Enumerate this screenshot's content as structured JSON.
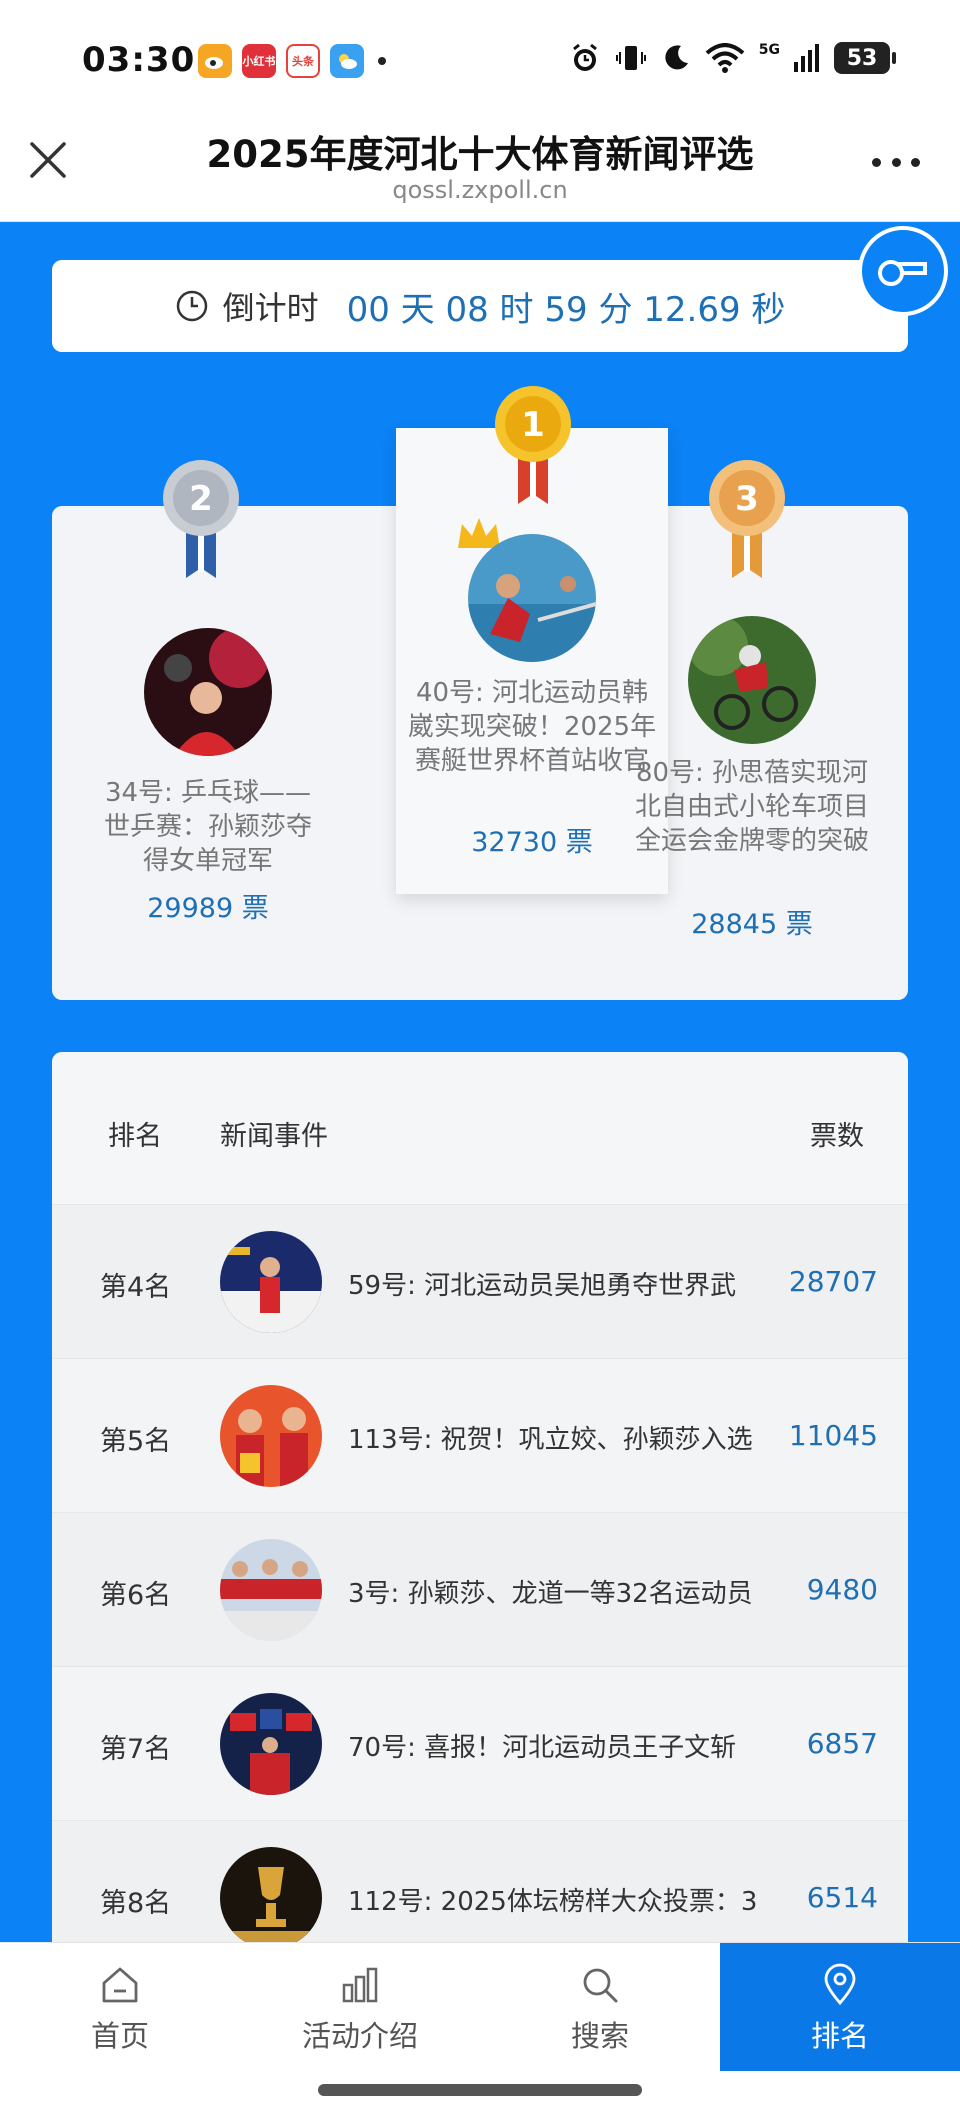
{
  "status_bar": {
    "time": "03:30",
    "apps": [
      {
        "name": "weibo-app-icon",
        "label": "",
        "color": "#f5a623"
      },
      {
        "name": "xiaohongshu-app-icon",
        "label": "小红书",
        "color": "#e0313a"
      },
      {
        "name": "toutiao-app-icon",
        "label": "头条",
        "color": "#e8413b"
      },
      {
        "name": "weather-app-icon",
        "label": "",
        "color": "#3aa0f0"
      }
    ],
    "network": "5G",
    "battery": "53"
  },
  "header": {
    "title": "2025年度河北十大体育新闻评选",
    "url": "qossl.zxpoll.cn"
  },
  "countdown": {
    "label": "倒计时",
    "value": "00 天 08 时 59 分 12.69 秒"
  },
  "podium": [
    {
      "rank": 2,
      "title": "34号: 乒乓球——世乒赛：孙颖莎夺得女单冠军",
      "votes": "29989 票",
      "medal_color": "#b8bec6"
    },
    {
      "rank": 1,
      "title": "40号: 河北运动员韩崴实现突破！2025年赛艇世界杯首站收官",
      "votes": "32730 票",
      "medal_color": "#f2b71a"
    },
    {
      "rank": 3,
      "title": "80号: 孙思蓓实现河北自由式小轮车项目全运会金牌零的突破",
      "votes": "28845 票",
      "medal_color": "#e9a84a"
    }
  ],
  "table": {
    "headers": {
      "rank": "排名",
      "news": "新闻事件",
      "votes": "票数"
    },
    "rows": [
      {
        "rank": "第4名",
        "title": "59号: 河北运动员吴旭勇夺世界武",
        "votes": "28707"
      },
      {
        "rank": "第5名",
        "title": "113号: 祝贺！巩立姣、孙颖莎入选",
        "votes": "11045"
      },
      {
        "rank": "第6名",
        "title": "3号: 孙颖莎、龙道一等32名运动员",
        "votes": "9480"
      },
      {
        "rank": "第7名",
        "title": "70号: 喜报！河北运动员王子文斩",
        "votes": "6857"
      },
      {
        "rank": "第8名",
        "title": "112号: 2025体坛榜样大众投票：3",
        "votes": "6514"
      }
    ]
  },
  "nav": [
    {
      "label": "首页",
      "icon": "home-icon",
      "active": false
    },
    {
      "label": "活动介绍",
      "icon": "bar-chart-icon",
      "active": false
    },
    {
      "label": "搜索",
      "icon": "search-icon",
      "active": false
    },
    {
      "label": "排名",
      "icon": "location-pin-icon",
      "active": true
    }
  ]
}
